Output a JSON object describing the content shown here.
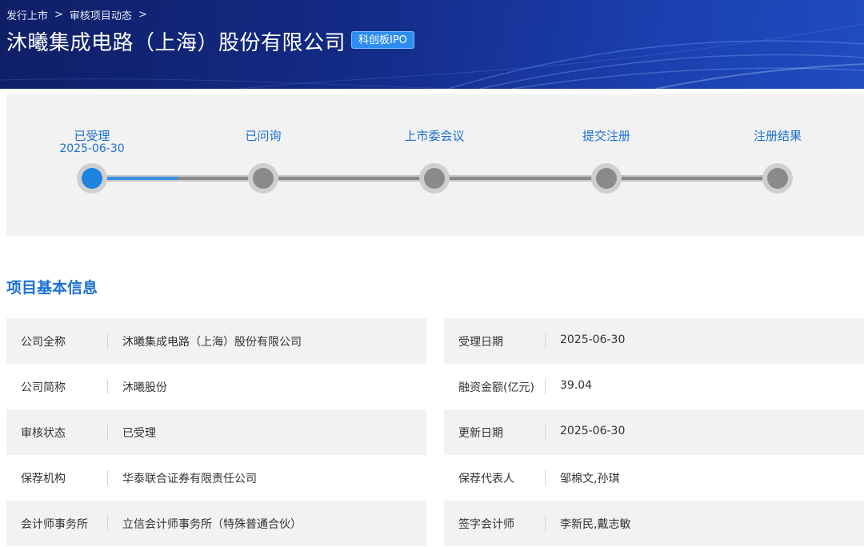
{
  "breadcrumb": {
    "items": [
      "发行上市",
      "审核项目动态"
    ],
    "separator": ">"
  },
  "header": {
    "company_name": "沐曦集成电路（上海）股份有限公司",
    "board_badge": "科创板IPO"
  },
  "progress": {
    "current_stage_index": 0,
    "stages": [
      {
        "label": "已受理",
        "date": "2025-06-30"
      },
      {
        "label": "已问询",
        "date": ""
      },
      {
        "label": "上市委会议",
        "date": ""
      },
      {
        "label": "提交注册",
        "date": ""
      },
      {
        "label": "注册结果",
        "date": ""
      }
    ]
  },
  "section": {
    "title": "项目基本信息"
  },
  "info": {
    "left": [
      {
        "label": "公司全称",
        "value": "沐曦集成电路（上海）股份有限公司"
      },
      {
        "label": "公司简称",
        "value": "沐曦股份"
      },
      {
        "label": "审核状态",
        "value": "已受理"
      },
      {
        "label": "保荐机构",
        "value": "华泰联合证券有限责任公司"
      },
      {
        "label": "会计师事务所",
        "value": "立信会计师事务所（特殊普通合伙）"
      }
    ],
    "right": [
      {
        "label": "受理日期",
        "value": "2025-06-30"
      },
      {
        "label": "融资金额(亿元)",
        "value": "39.04"
      },
      {
        "label": "更新日期",
        "value": "2025-06-30"
      },
      {
        "label": "保荐代表人",
        "value": "邹棉文,孙琪"
      },
      {
        "label": "签字会计师",
        "value": "李新民,戴志敏"
      }
    ]
  },
  "colors": {
    "accent": "#1a6fd3",
    "banner_dark": "#0f1f66",
    "banner_light": "#1f4cc0",
    "badge": "#2e8ef0",
    "row_shade": "#f3f2f2"
  }
}
